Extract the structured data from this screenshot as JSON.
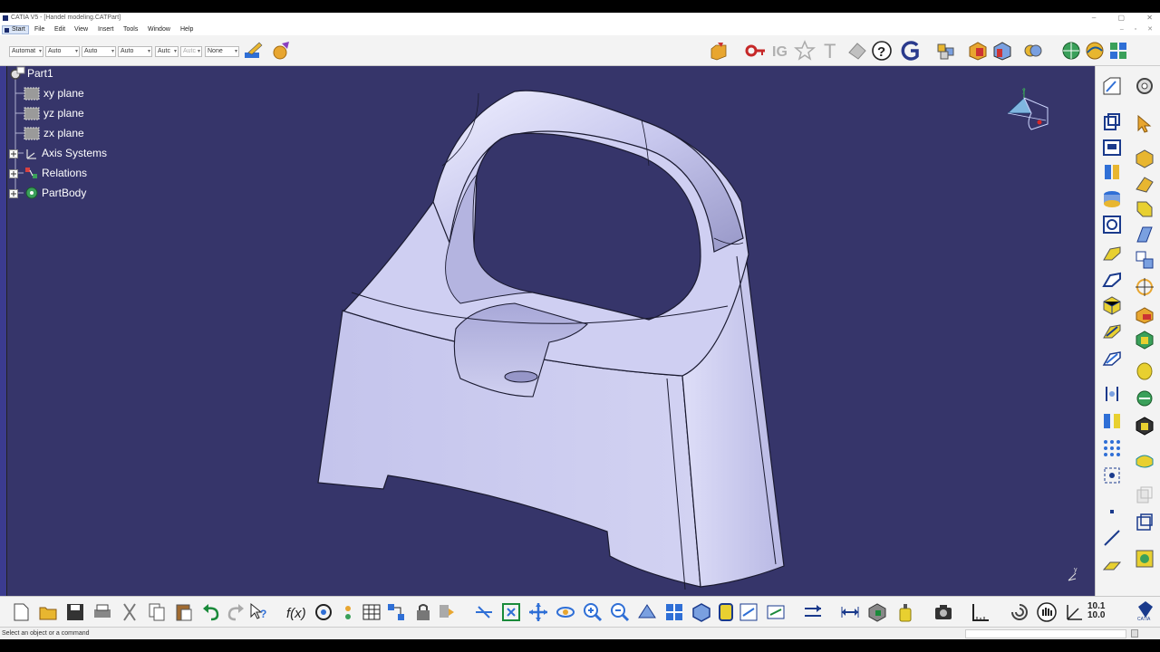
{
  "window": {
    "title": "CATIA V5 - [Handel modeling.CATPart]",
    "controls": [
      "–",
      "▢",
      "✕"
    ]
  },
  "menu": {
    "items": [
      "Start",
      "File",
      "Edit",
      "View",
      "Insert",
      "Tools",
      "Window",
      "Help"
    ],
    "doc_controls": [
      "–",
      "▫",
      "✕"
    ]
  },
  "graphic_properties": {
    "combos": [
      "Automat",
      "Auto",
      "Auto",
      "Auto",
      "Autc",
      "Autc",
      "None"
    ]
  },
  "tree": {
    "root": "Part1",
    "items": [
      "xy plane",
      "yz plane",
      "zx plane",
      "Axis Systems",
      "Relations",
      "PartBody"
    ]
  },
  "compass": {
    "axis_label": "y"
  },
  "axis_indicator": {
    "label": "y"
  },
  "status": {
    "message": "Select an object or a command"
  },
  "bottom_toolbar": {
    "measure_readout": "10.1\n10.0"
  },
  "colors": {
    "viewport_bg": "#36356a",
    "part_face": "#c9c9ee",
    "part_edge": "#1a1a30",
    "toolbar_bg": "#f3f3f3"
  }
}
